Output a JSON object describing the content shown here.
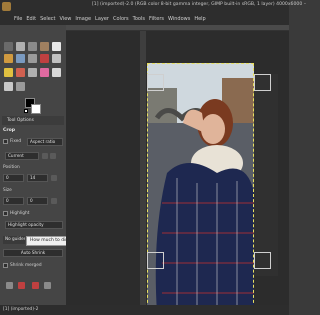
{
  "window": {
    "title": "[1] (imported)-2.0 (RGB color 8-bit gamma integer, GIMP built-in sRGB, 1 layer) 4000x6000 –"
  },
  "menubar": {
    "items": [
      "File",
      "Edit",
      "Select",
      "View",
      "Image",
      "Layer",
      "Colors",
      "Tools",
      "Filters",
      "Windows",
      "Help"
    ]
  },
  "tool_options": {
    "tab_label": "Tool Options",
    "title": "Crop",
    "fixed_label": "Fixed",
    "fixed_value": "Aspect ratio",
    "current_value": "Current",
    "position_label": "Position",
    "position_x": "0",
    "position_y": "14",
    "size_label": "Size",
    "size_w": "0",
    "size_h": "0",
    "highlight_label": "Highlight",
    "highlight_opacity_label": "Highlight opacity",
    "guides_value": "No guides",
    "auto_shrink_label": "Auto Shrink",
    "shrink_merged_label": "Shrink merged",
    "tooltip": "How much to dim everything outside selection"
  },
  "statusbar": {
    "text": "[1] (imported)-2"
  },
  "colors": {
    "foreground": "#000000",
    "background": "#ffffff",
    "selection_border": "#e8e060"
  }
}
